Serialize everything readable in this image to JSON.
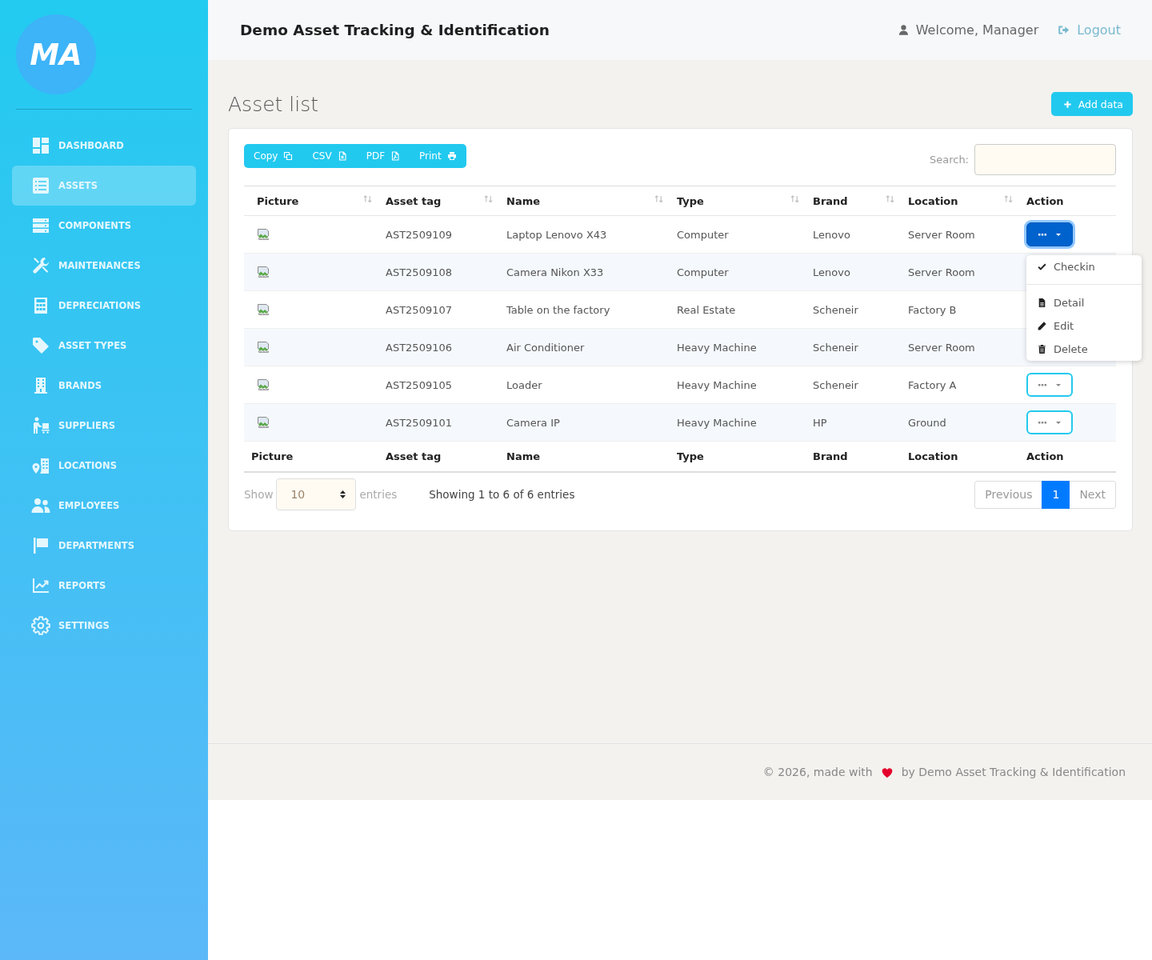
{
  "sidebar": {
    "logo": "MA",
    "items": [
      {
        "label": "DASHBOARD",
        "selected": false
      },
      {
        "label": "ASSETS",
        "selected": true
      },
      {
        "label": "COMPONENTS",
        "selected": false
      },
      {
        "label": "MAINTENANCES",
        "selected": false
      },
      {
        "label": "DEPRECIATIONS",
        "selected": false
      },
      {
        "label": "ASSET TYPES",
        "selected": false
      },
      {
        "label": "BRANDS",
        "selected": false
      },
      {
        "label": "SUPPLIERS",
        "selected": false
      },
      {
        "label": "LOCATIONS",
        "selected": false
      },
      {
        "label": "EMPLOYEES",
        "selected": false
      },
      {
        "label": "DEPARTMENTS",
        "selected": false
      },
      {
        "label": "REPORTS",
        "selected": false
      },
      {
        "label": "SETTINGS",
        "selected": false
      }
    ]
  },
  "header": {
    "title": "Demo Asset Tracking & Identification",
    "user": "Welcome, Manager",
    "logout": "Logout"
  },
  "page": {
    "title": "Asset list",
    "add_button": "Add data"
  },
  "toolbar": {
    "export_buttons": [
      "Copy",
      "CSV",
      "PDF",
      "Print"
    ],
    "search": {
      "label": "Search:"
    }
  },
  "table": {
    "columns": [
      {
        "label": "Picture",
        "sortable": true
      },
      {
        "label": "Asset tag",
        "sortable": true
      },
      {
        "label": "Name",
        "sortable": true
      },
      {
        "label": "Type",
        "sortable": true
      },
      {
        "label": "Brand",
        "sortable": true
      },
      {
        "label": "Location",
        "sortable": true
      },
      {
        "label": "Action",
        "sortable": false
      }
    ],
    "rows": [
      {
        "asset_tag": "AST2509109",
        "name": "Laptop Lenovo X43",
        "type": "Computer",
        "brand": "Lenovo",
        "location": "Server Room",
        "action": {
          "open": true
        }
      },
      {
        "asset_tag": "AST2509108",
        "name": "Camera Nikon X33",
        "type": "Computer",
        "brand": "Lenovo",
        "location": "Server Room"
      },
      {
        "asset_tag": "AST2509107",
        "name": "Table on the factory",
        "type": "Real Estate",
        "brand": "Scheneir",
        "location": "Factory B"
      },
      {
        "asset_tag": "AST2509106",
        "name": "Air Conditioner",
        "type": "Heavy Machine",
        "brand": "Scheneir",
        "location": "Server Room"
      },
      {
        "asset_tag": "AST2509105",
        "name": "Loader",
        "type": "Heavy Machine",
        "brand": "Scheneir",
        "location": "Factory A",
        "action": {
          "open": false
        }
      },
      {
        "asset_tag": "AST2509101",
        "name": "Camera IP",
        "type": "Heavy Machine",
        "brand": "HP",
        "location": "Ground",
        "action": {
          "open": false
        }
      }
    ],
    "footer_columns": [
      "Picture",
      "Asset tag",
      "Name",
      "Type",
      "Brand",
      "Location",
      "Action"
    ]
  },
  "action_menu": {
    "groups": [
      [
        "Checkin"
      ],
      [
        "Detail",
        "Edit",
        "Delete"
      ]
    ]
  },
  "length_menu": {
    "label": "Show",
    "value": "10",
    "suffix": "entries"
  },
  "info": "Showing 1 to 6 of 6 entries",
  "pagination": [
    {
      "label": "Previous",
      "selected": false
    },
    {
      "label": "1",
      "selected": true
    },
    {
      "label": "Next",
      "selected": false
    }
  ],
  "footer": {
    "text": "© 2026, made with",
    "credit": "by Demo Asset Tracking & Identification"
  }
}
